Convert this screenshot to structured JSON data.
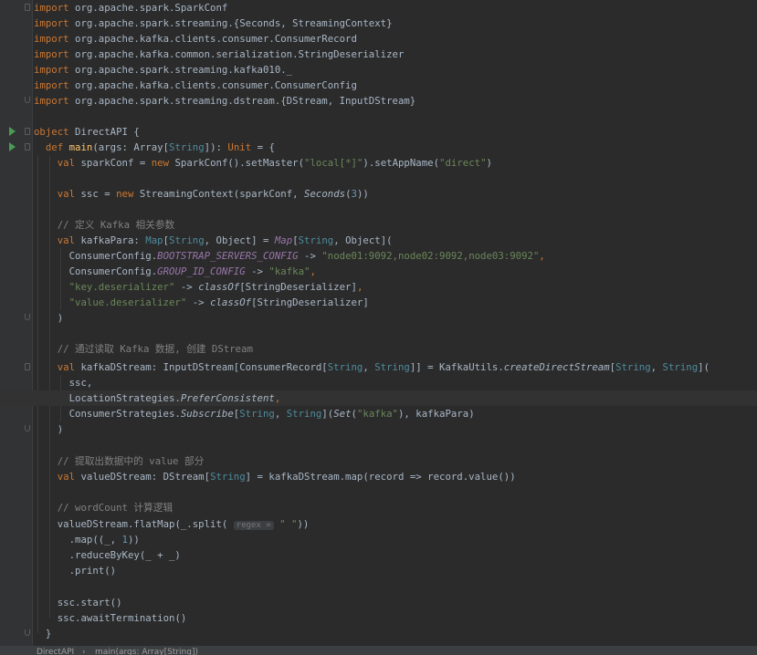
{
  "code": {
    "imports": [
      {
        "pkg": "org.apache.spark.SparkConf"
      },
      {
        "pkg": "org.apache.spark.streaming.{Seconds, StreamingContext}"
      },
      {
        "pkg": "org.apache.kafka.clients.consumer.ConsumerRecord"
      },
      {
        "pkg": "org.apache.kafka.common.serialization.StringDeserializer"
      },
      {
        "pkg": "org.apache.spark.streaming.kafka010._"
      },
      {
        "pkg": "org.apache.kafka.clients.consumer.ConsumerConfig"
      },
      {
        "pkg": "org.apache.spark.streaming.dstream.{DStream, InputDStream}"
      }
    ],
    "tokens": {
      "kw_import": "import",
      "kw_object": "object",
      "kw_def": "def",
      "kw_val": "val",
      "kw_new": "new",
      "obj_name": "DirectAPI",
      "brace_open": " {",
      "brace_close": "}",
      "paren_close": ")",
      "comma": ",",
      "main": "main",
      "args_open": "(args: ",
      "Array": "Array",
      "String": "String",
      "Unit": "Unit",
      "br_open": "[",
      "br_close": "]",
      "sig_close": "]): ",
      "eq_brace": " = {",
      "sparkConf_decl": " sparkConf = ",
      "SparkConf_call": " SparkConf().setMaster(",
      "local": "\"local[*]\"",
      "setAppName": ").setAppName(",
      "direct": "\"direct\"",
      "ssc_decl": " ssc = ",
      "StreamingContext_call": " StreamingContext(sparkConf, ",
      "Seconds": "Seconds",
      "p_open": "(",
      "three": "3",
      "pp_close": "))",
      "comment1": "// 定义 Kafka 相关参数",
      "kafkaPara_decl": " kafkaPara: ",
      "Map": "Map",
      "comma_sp": ", ",
      "Object_br": "Object]",
      "eq_sp": " = ",
      "Object_paren": "Object](",
      "CC1": "ConsumerConfig.",
      "BOOTSTRAP": "BOOTSTRAP_SERVERS_CONFIG",
      "arrow": " -> ",
      "servers": "\"node01:9092,node02:9092,node03:9092\"",
      "GROUP_ID": "GROUP_ID_CONFIG",
      "kafka_str": "\"kafka\"",
      "key_deser": "\"key.deserializer\"",
      "classOf": "classOf",
      "StringDeserializer": "[StringDeserializer]",
      "value_deser": "\"value.deserializer\"",
      "comment2": "// 通过读取 Kafka 数据, 创建 DStream",
      "kafkaDStream_decl": " kafkaDStream: InputDStream[ConsumerRecord[",
      "mid_close": "]] = KafkaUtils.",
      "createDirectStream": "createDirectStream",
      "br_close_paren": "](",
      "ssc_arg": "ssc,",
      "LocStrat": "LocationStrategies.",
      "PreferConsistent": "PreferConsistent",
      "ConsStrat": "ConsumerStrategies.",
      "Subscribe": "Subscribe",
      "Set": "Set",
      "kafkaPara_end": "), kafkaPara)",
      "comment3": "// 提取出数据中的 value 部分",
      "valueDStream_decl": " valueDStream: DStream[",
      "map_value": "] = kafkaDStream.map(record => record.value())",
      "comment4": "// wordCount 计算逻辑",
      "flatMap": "valueDStream.flatMap(_.split( ",
      "regex_hint": "regex =",
      "space_str": "\" \"",
      "map_line_a": ".map((_, ",
      "one": "1",
      "reduce": ".reduceByKey(_ + _)",
      "print": ".print()",
      "ssc_start": "ssc.start()",
      "ssc_await": "ssc.awaitTermination()"
    }
  },
  "breadcrumb": {
    "object": "DirectAPI",
    "separator": "›",
    "method": "main(args: Array[String])"
  }
}
